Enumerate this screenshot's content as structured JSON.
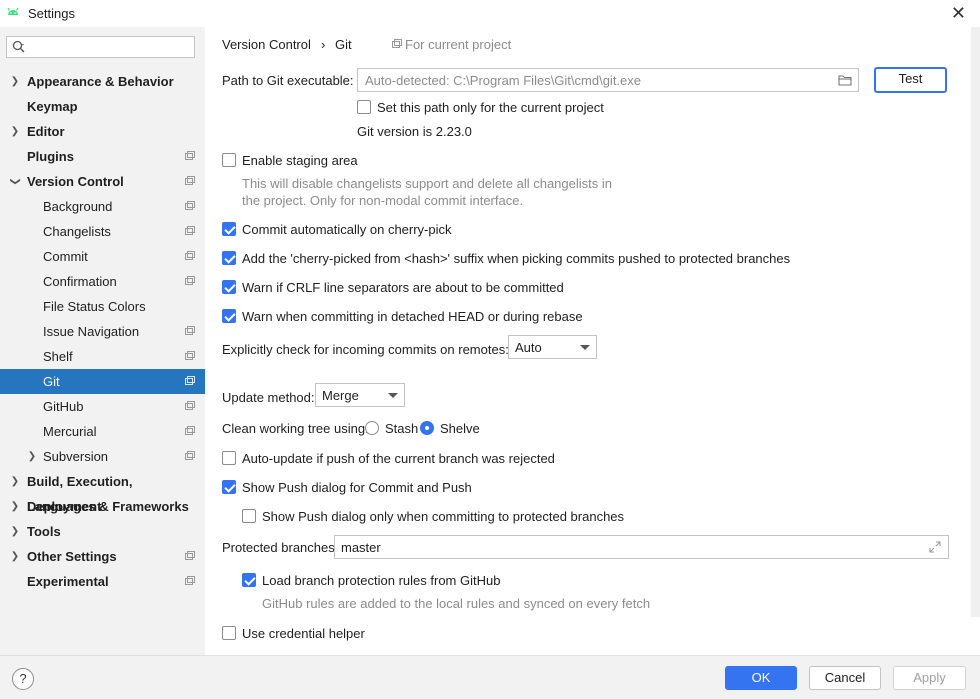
{
  "window": {
    "title": "Settings"
  },
  "search": {
    "placeholder": ""
  },
  "sidebar": {
    "items": [
      {
        "label": "Appearance & Behavior"
      },
      {
        "label": "Keymap"
      },
      {
        "label": "Editor"
      },
      {
        "label": "Plugins"
      },
      {
        "label": "Version Control"
      },
      {
        "label": "Background"
      },
      {
        "label": "Changelists"
      },
      {
        "label": "Commit"
      },
      {
        "label": "Confirmation"
      },
      {
        "label": "File Status Colors"
      },
      {
        "label": "Issue Navigation"
      },
      {
        "label": "Shelf"
      },
      {
        "label": "Git"
      },
      {
        "label": "GitHub"
      },
      {
        "label": "Mercurial"
      },
      {
        "label": "Subversion"
      },
      {
        "label": "Build, Execution, Deployment"
      },
      {
        "label": "Languages & Frameworks"
      },
      {
        "label": "Tools"
      },
      {
        "label": "Other Settings"
      },
      {
        "label": "Experimental"
      }
    ]
  },
  "breadcrumb": {
    "parent": "Version Control",
    "separator": "›",
    "current": "Git",
    "scope": "For current project"
  },
  "git": {
    "path_label": "Path to Git executable:",
    "path_placeholder": "Auto-detected: C:\\Program Files\\Git\\cmd\\git.exe",
    "test_button": "Test",
    "current_project_only": "Set this path only for the current project",
    "version_text": "Git version is 2.23.0",
    "staging_label": "Enable staging area",
    "staging_hint_1": "This will disable changelists support and delete all changelists in",
    "staging_hint_2": "the project. Only for non-modal commit interface.",
    "cherry_pick_commit": "Commit automatically on cherry-pick",
    "cherry_pick_suffix": "Add the 'cherry-picked from <hash>' suffix when picking commits pushed to protected branches",
    "warn_crlf": "Warn if CRLF line separators are about to be committed",
    "warn_detached": "Warn when committing in detached HEAD or during rebase",
    "incoming_label": "Explicitly check for incoming commits on remotes:",
    "incoming_value": "Auto",
    "update_method_label": "Update method:",
    "update_method_value": "Merge",
    "clean_tree_label": "Clean working tree using:",
    "clean_stash": "Stash",
    "clean_shelve": "Shelve",
    "auto_update_label": "Auto-update if push of the current branch was rejected",
    "show_push_label": "Show Push dialog for Commit and Push",
    "show_push_protected_label": "Show Push dialog only when committing to protected branches",
    "protected_label": "Protected branches:",
    "protected_value": "master",
    "load_rules_label": "Load branch protection rules from GitHub",
    "load_rules_hint": "GitHub rules are added to the local rules and synced on every fetch",
    "credential_label": "Use credential helper"
  },
  "footer": {
    "help": "?",
    "ok": "OK",
    "cancel": "Cancel",
    "apply": "Apply"
  },
  "colors": {
    "accent": "#3574f0",
    "selection": "#2675bf",
    "sidebar_bg": "#f2f2f2"
  }
}
